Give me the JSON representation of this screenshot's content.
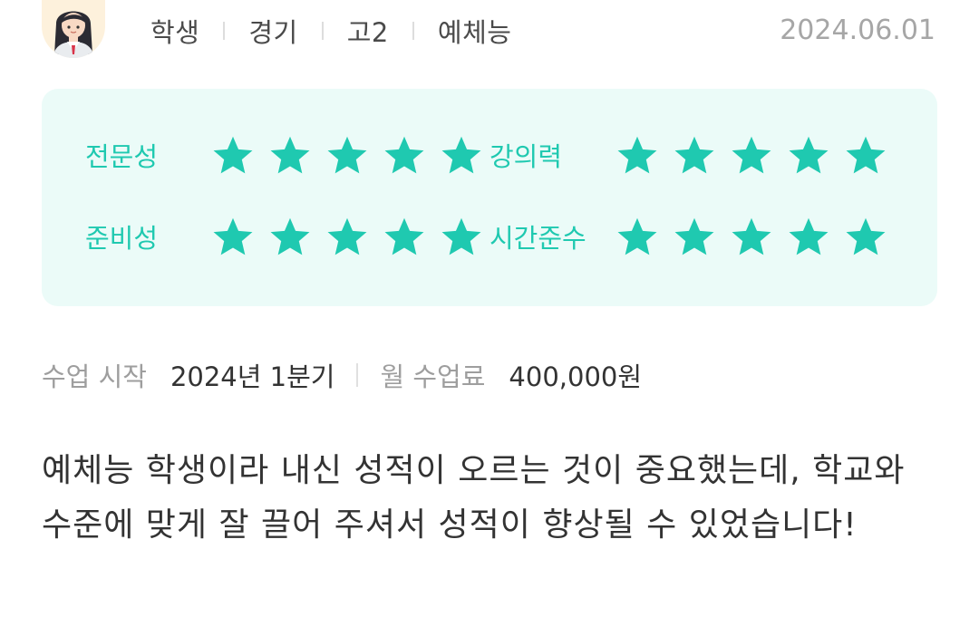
{
  "header": {
    "avatar_icon": "student-girl-avatar-icon",
    "meta": [
      "학생",
      "경기",
      "고2",
      "예체능"
    ],
    "date": "2024.06.01"
  },
  "ratings": {
    "accent_color": "#1fc9b0",
    "card_background": "#ebfbf8",
    "max_stars": 5,
    "items": [
      {
        "label": "전문성",
        "stars": 5
      },
      {
        "label": "강의력",
        "stars": 5
      },
      {
        "label": "준비성",
        "stars": 5
      },
      {
        "label": "시간준수",
        "stars": 5
      }
    ]
  },
  "lesson": {
    "start_key": "수업 시작",
    "start_value": "2024년 1분기",
    "fee_key": "월 수업료",
    "fee_value": "400,000원"
  },
  "review": {
    "text": "예체능 학생이라 내신 성적이 오르는 것이 중요했는데, 학교와 수준에 맞게 잘 끌어 주셔서 성적이 향상될 수 있었습니다!"
  }
}
